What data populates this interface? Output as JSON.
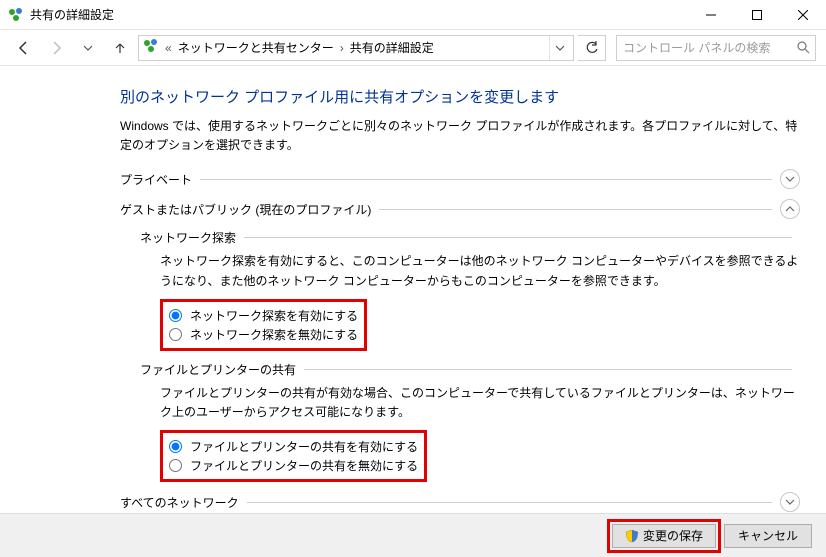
{
  "window": {
    "title": "共有の詳細設定"
  },
  "breadcrumb": {
    "seg1": "ネットワークと共有センター",
    "seg2": "共有の詳細設定"
  },
  "search": {
    "placeholder": "コントロール パネルの検索"
  },
  "main": {
    "heading": "別のネットワーク プロファイル用に共有オプションを変更します",
    "description": "Windows では、使用するネットワークごとに別々のネットワーク プロファイルが作成されます。各プロファイルに対して、特定のオプションを選択できます。"
  },
  "sections": {
    "private": {
      "label": "プライベート",
      "expanded": false
    },
    "guest": {
      "label": "ゲストまたはパブリック (現在のプロファイル)",
      "expanded": true,
      "discovery": {
        "title": "ネットワーク探索",
        "text": "ネットワーク探索を有効にすると、このコンピューターは他のネットワーク コンピューターやデバイスを参照できるようになり、また他のネットワーク コンピューターからもこのコンピューターを参照できます。",
        "opt_on": "ネットワーク探索を有効にする",
        "opt_off": "ネットワーク探索を無効にする",
        "value": "on"
      },
      "fileshare": {
        "title": "ファイルとプリンターの共有",
        "text": "ファイルとプリンターの共有が有効な場合、このコンピューターで共有しているファイルとプリンターは、ネットワーク上のユーザーからアクセス可能になります。",
        "opt_on": "ファイルとプリンターの共有を有効にする",
        "opt_off": "ファイルとプリンターの共有を無効にする",
        "value": "on"
      }
    },
    "all": {
      "label": "すべてのネットワーク",
      "expanded": false
    }
  },
  "footer": {
    "save": "変更の保存",
    "cancel": "キャンセル"
  },
  "colors": {
    "heading": "#003399",
    "highlight": "#e30000"
  }
}
